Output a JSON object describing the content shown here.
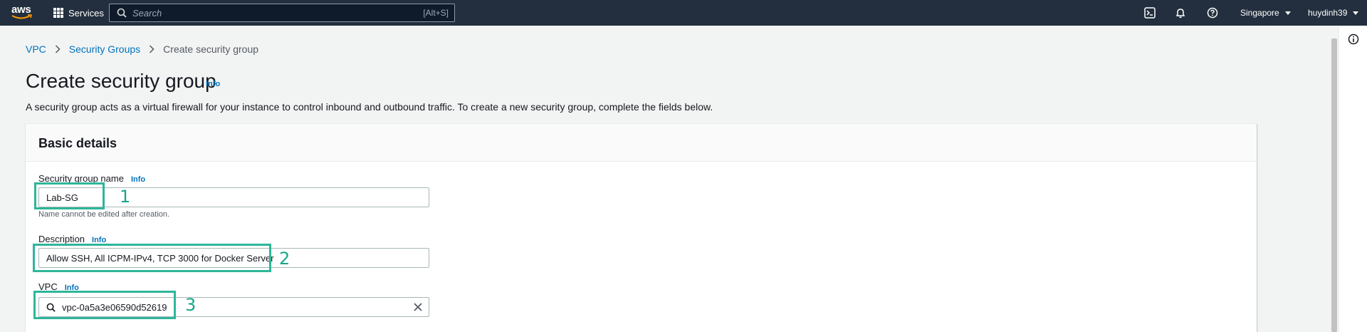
{
  "topnav": {
    "logo": "aws",
    "services_label": "Services",
    "search_placeholder": "Search",
    "search_shortcut": "[Alt+S]",
    "region": "Singapore",
    "user": "huydinh39",
    "icons": [
      "cloudshell-icon",
      "bell-icon",
      "help-icon"
    ]
  },
  "breadcrumb": {
    "items": [
      "VPC",
      "Security Groups"
    ],
    "current": "Create security group"
  },
  "page": {
    "title": "Create security group",
    "title_info": "Info",
    "description": "A security group acts as a virtual firewall for your instance to control inbound and outbound traffic. To create a new security group, complete the fields below."
  },
  "panel": {
    "title": "Basic details",
    "name_field": {
      "label": "Security group name",
      "info": "Info",
      "value": "Lab-SG",
      "constraint": "Name cannot be edited after creation."
    },
    "description_field": {
      "label": "Description",
      "info": "Info",
      "value": "Allow SSH, All ICPM-IPv4, TCP 3000 for Docker Server"
    },
    "vpc_field": {
      "label": "VPC",
      "info": "Info",
      "value": "vpc-0a5a3e06590d52619"
    }
  },
  "annotations": {
    "one": "1",
    "two": "2",
    "three": "3",
    "color": "#2eb69a"
  },
  "colors": {
    "nav_bg": "#232f3e",
    "link": "#0073bb",
    "page_bg": "#f2f3f3"
  }
}
